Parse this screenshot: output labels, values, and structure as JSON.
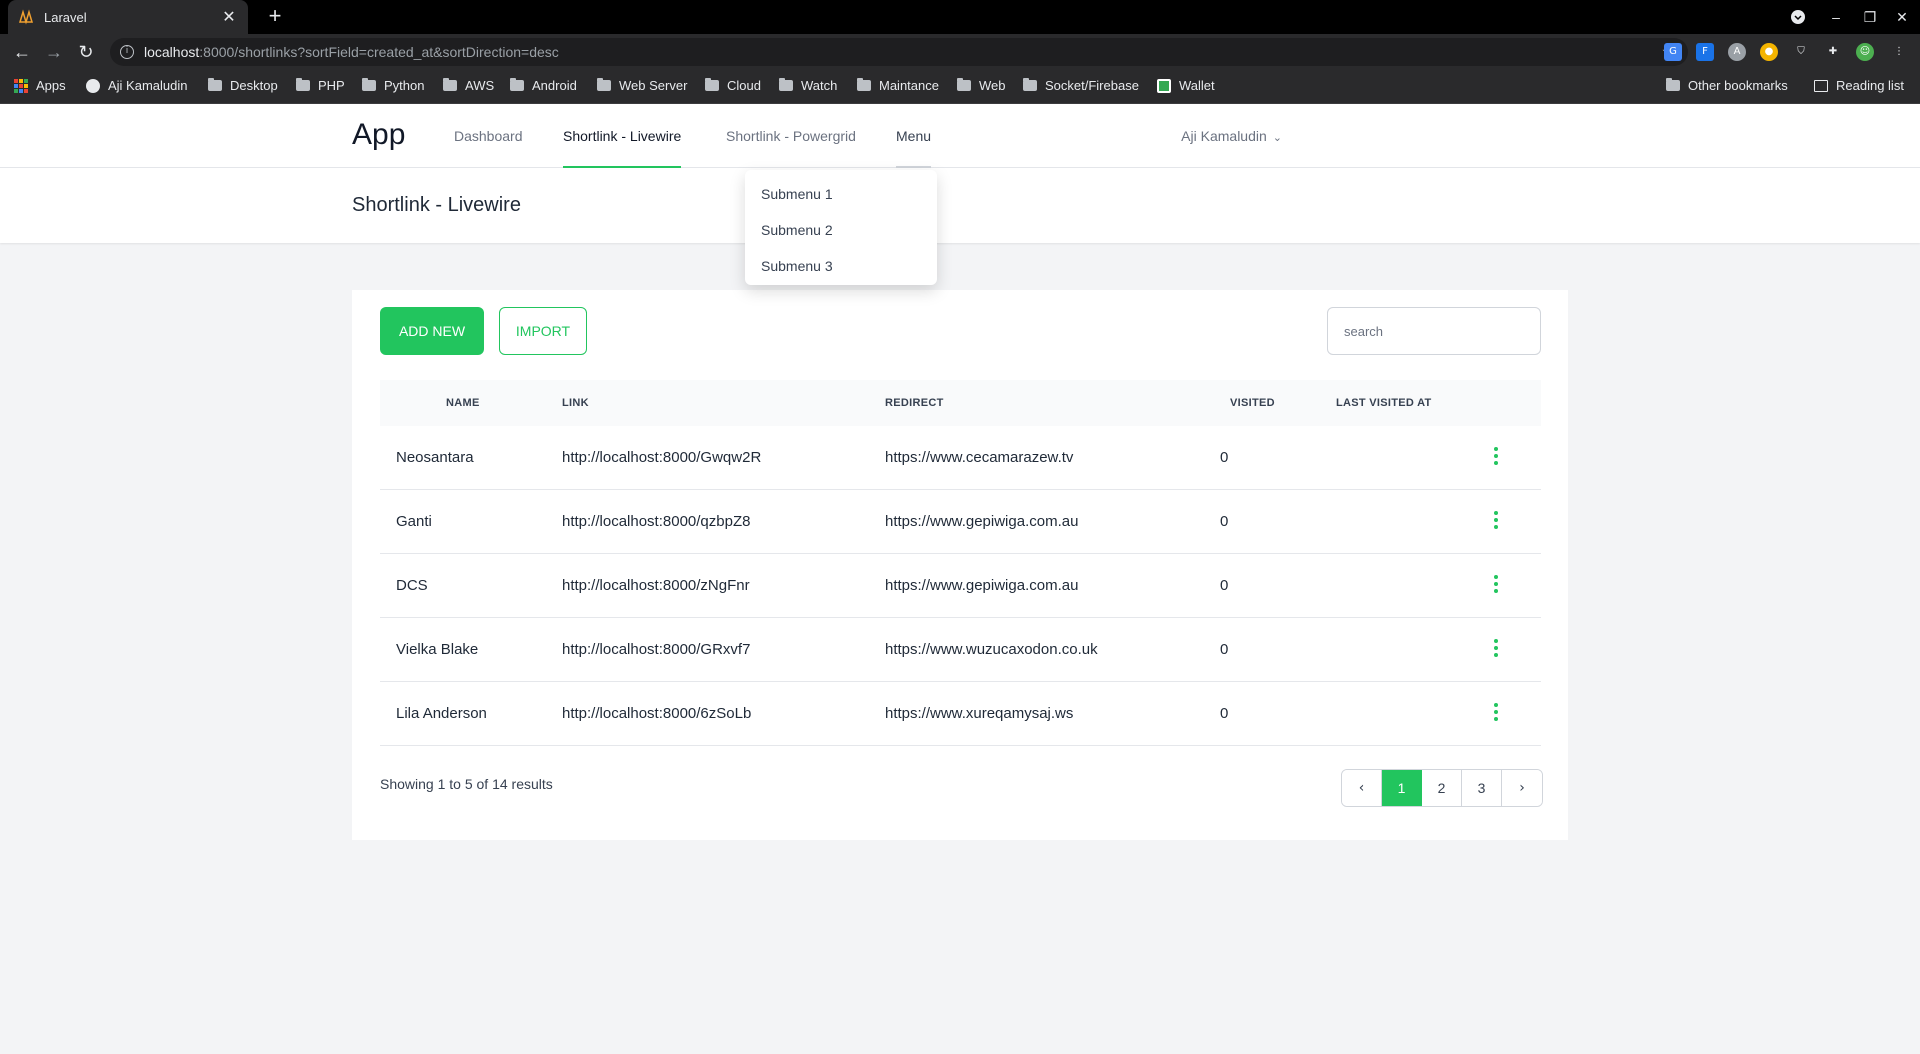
{
  "browser": {
    "tab_title": "Laravel",
    "url_host": "localhost",
    "url_rest": ":8000/shortlinks?sortField=created_at&sortDirection=desc",
    "bookmarks": [
      "Apps",
      "Aji Kamaludin",
      "Desktop",
      "PHP",
      "Python",
      "AWS",
      "Android",
      "Web Server",
      "Cloud",
      "Watch",
      "Maintance",
      "Web",
      "Socket/Firebase",
      "Wallet"
    ],
    "other_bookmarks": "Other bookmarks",
    "reading_list": "Reading list"
  },
  "nav": {
    "brand": "App",
    "links": [
      "Dashboard",
      "Shortlink - Livewire",
      "Shortlink - Powergrid",
      "Menu"
    ],
    "user": "Aji Kamaludin"
  },
  "dropdown": {
    "items": [
      "Submenu 1",
      "Submenu 2",
      "Submenu 3"
    ]
  },
  "page": {
    "title": "Shortlink - Livewire"
  },
  "toolbar": {
    "add_label": "ADD NEW",
    "import_label": "IMPORT",
    "search_placeholder": "search"
  },
  "table": {
    "columns": [
      "NAME",
      "LINK",
      "REDIRECT",
      "VISITED",
      "LAST VISITED AT"
    ],
    "rows": [
      {
        "name": "Neosantara",
        "link": "http://localhost:8000/Gwqw2R",
        "redirect": "https://www.cecamarazew.tv",
        "visited": "0",
        "last_visited": ""
      },
      {
        "name": "Ganti",
        "link": "http://localhost:8000/qzbpZ8",
        "redirect": "https://www.gepiwiga.com.au",
        "visited": "0",
        "last_visited": ""
      },
      {
        "name": "DCS",
        "link": "http://localhost:8000/zNgFnr",
        "redirect": "https://www.gepiwiga.com.au",
        "visited": "0",
        "last_visited": ""
      },
      {
        "name": "Vielka Blake",
        "link": "http://localhost:8000/GRxvf7",
        "redirect": "https://www.wuzucaxodon.co.uk",
        "visited": "0",
        "last_visited": ""
      },
      {
        "name": "Lila Anderson",
        "link": "http://localhost:8000/6zSoLb",
        "redirect": "https://www.xureqamysaj.ws",
        "visited": "0",
        "last_visited": ""
      }
    ]
  },
  "pagination": {
    "summary": "Showing 1 to 5 of 14 results",
    "pages": [
      "1",
      "2",
      "3"
    ],
    "current": "1",
    "prev": "‹",
    "next": "›"
  },
  "colors": {
    "accent": "#22c55e"
  }
}
